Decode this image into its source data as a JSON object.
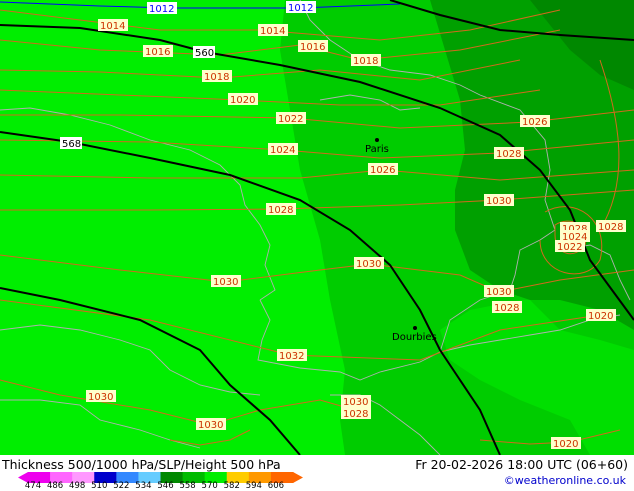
{
  "map": {
    "isobars": [
      {
        "label": "1012",
        "color": "#0000ff"
      },
      {
        "label": "1012",
        "color": "#0000ff"
      },
      {
        "label": "1014"
      },
      {
        "label": "1014"
      },
      {
        "label": "1016"
      },
      {
        "label": "1016"
      },
      {
        "label": "1018"
      },
      {
        "label": "1018"
      },
      {
        "label": "1020"
      },
      {
        "label": "1022"
      },
      {
        "label": "1024"
      },
      {
        "label": "1026"
      },
      {
        "label": "1026"
      },
      {
        "label": "1028"
      },
      {
        "label": "1028"
      },
      {
        "label": "1030"
      },
      {
        "label": "1030"
      },
      {
        "label": "1030"
      },
      {
        "label": "1030"
      },
      {
        "label": "1028"
      },
      {
        "label": "1032"
      },
      {
        "label": "1030"
      },
      {
        "label": "1030"
      },
      {
        "label": "1030"
      },
      {
        "label": "1028"
      },
      {
        "label": "1028"
      },
      {
        "label": "1024"
      },
      {
        "label": "1022"
      },
      {
        "label": "1028"
      },
      {
        "label": "1020"
      },
      {
        "label": "1020"
      }
    ],
    "height_contours": [
      {
        "label": "560"
      },
      {
        "label": "568"
      }
    ],
    "cities": [
      {
        "name": "Paris"
      },
      {
        "name": "Dourbies"
      }
    ],
    "colors": {
      "thickness_light": "#00ee00",
      "thickness_mid": "#00cc00",
      "thickness_dark": "#00a000",
      "thickness_darkest": "#008800",
      "isobar": "#d2691e",
      "height": "#000000",
      "borders": "#b0b0b0"
    }
  },
  "footer": {
    "title": "Thickness 500/1000 hPa/SLP/Height 500 hPa",
    "datetime": "Fr 20-02-2026 18:00 UTC (06+60)",
    "copyright": "©weatheronline.co.uk",
    "scale_ticks": [
      "474",
      "486",
      "498",
      "510",
      "522",
      "534",
      "546",
      "558",
      "570",
      "582",
      "594",
      "606"
    ],
    "scale_colors": [
      "#ee00ee",
      "#ff66ff",
      "#ff99ff",
      "#0000cc",
      "#3388ff",
      "#66ccff",
      "#008800",
      "#00bb00",
      "#00ee00",
      "#ffcc00",
      "#ff9900",
      "#ff6600"
    ]
  }
}
